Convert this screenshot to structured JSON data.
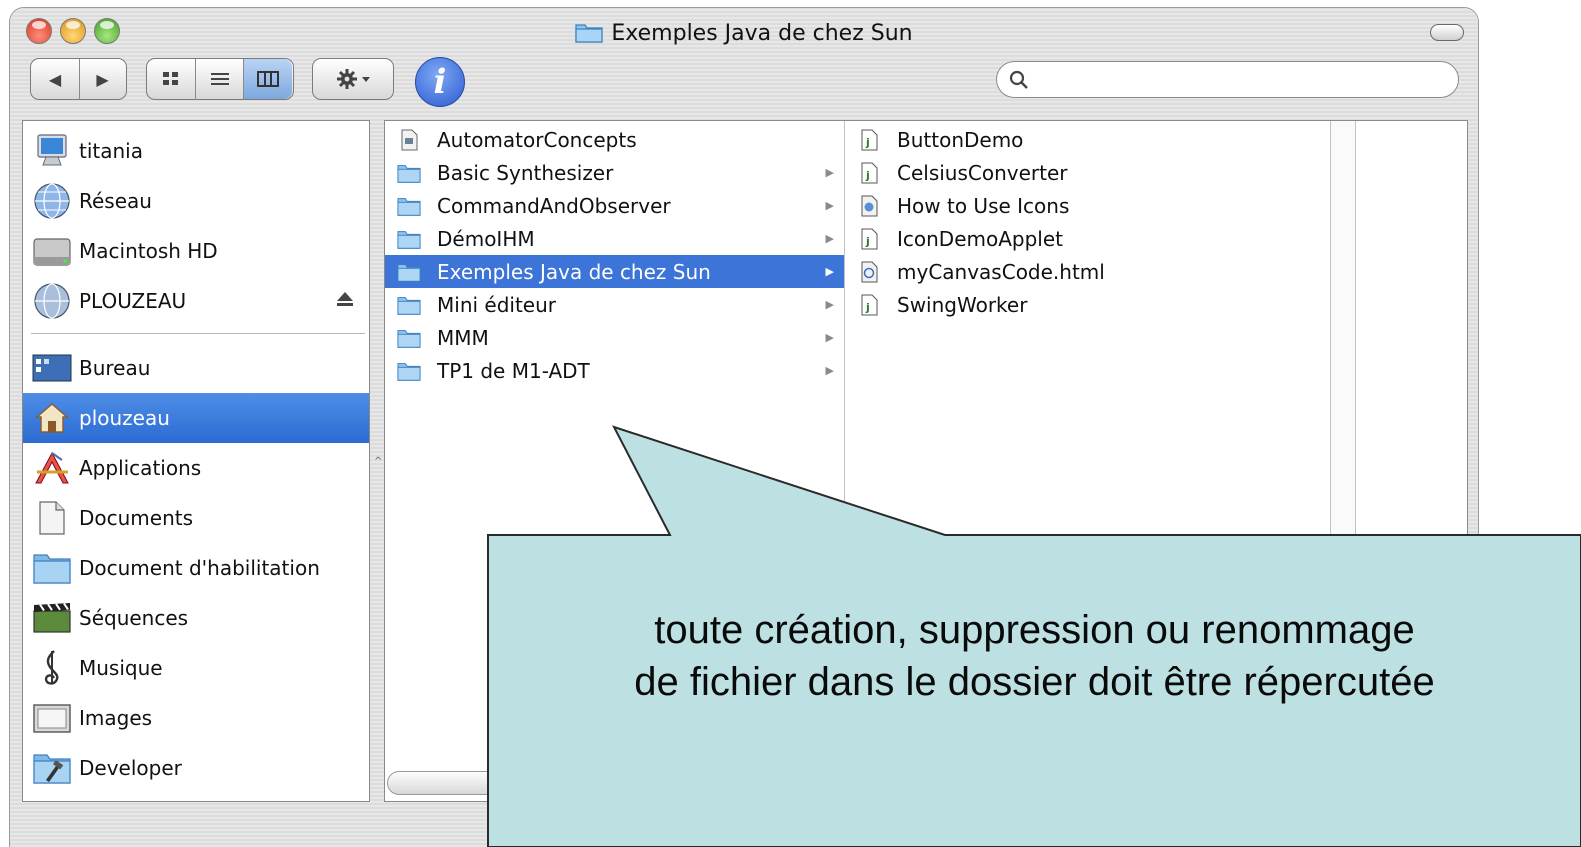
{
  "window": {
    "title": "Exemples Java de chez Sun",
    "title_icon": "folder-icon"
  },
  "toolbar": {
    "back_label": "◀",
    "forward_label": "▶",
    "view_icon_label": "icon-view-icon",
    "view_list_label": "list-view-icon",
    "view_column_label": "column-view-icon",
    "active_view": "column",
    "action_icon": "gear-icon",
    "info_label": "i",
    "search_placeholder": "",
    "search_value": ""
  },
  "sidebar": {
    "devices": [
      {
        "label": "titania",
        "icon": "computer-icon"
      },
      {
        "label": "Réseau",
        "icon": "network-globe-icon"
      },
      {
        "label": "Macintosh HD",
        "icon": "hard-drive-icon"
      },
      {
        "label": "PLOUZEAU",
        "icon": "network-volume-icon",
        "eject": true
      }
    ],
    "places": [
      {
        "label": "Bureau",
        "icon": "desktop-icon"
      },
      {
        "label": "plouzeau",
        "icon": "home-icon",
        "selected": true
      },
      {
        "label": "Applications",
        "icon": "applications-icon"
      },
      {
        "label": "Documents",
        "icon": "documents-icon"
      },
      {
        "label": "Document d'habilitation",
        "icon": "folder-icon"
      },
      {
        "label": "Séquences",
        "icon": "movies-icon"
      },
      {
        "label": "Musique",
        "icon": "music-icon"
      },
      {
        "label": "Images",
        "icon": "pictures-icon"
      },
      {
        "label": "Developer",
        "icon": "developer-folder-icon"
      }
    ]
  },
  "column1": [
    {
      "label": "AutomatorConcepts",
      "icon": "document-icon",
      "has_children": false
    },
    {
      "label": "Basic Synthesizer",
      "icon": "folder-icon",
      "has_children": true
    },
    {
      "label": "CommandAndObserver",
      "icon": "folder-icon",
      "has_children": true
    },
    {
      "label": "DémoIHM",
      "icon": "folder-icon",
      "has_children": true
    },
    {
      "label": "Exemples Java de chez Sun",
      "icon": "folder-icon",
      "has_children": true,
      "selected": true
    },
    {
      "label": "Mini éditeur",
      "icon": "folder-icon",
      "has_children": true
    },
    {
      "label": "MMM",
      "icon": "folder-icon",
      "has_children": true
    },
    {
      "label": "TP1 de M1-ADT",
      "icon": "folder-icon",
      "has_children": true
    }
  ],
  "column2": [
    {
      "label": "ButtonDemo",
      "icon": "java-file-icon"
    },
    {
      "label": "CelsiusConverter",
      "icon": "java-file-icon"
    },
    {
      "label": "How to Use Icons",
      "icon": "web-archive-icon"
    },
    {
      "label": "IconDemoApplet",
      "icon": "java-file-icon"
    },
    {
      "label": "myCanvasCode.html",
      "icon": "html-file-icon"
    },
    {
      "label": "SwingWorker",
      "icon": "java-file-icon"
    }
  ],
  "callout": {
    "line1": "toute création, suppression ou renommage",
    "line2": "de fichier dans le dossier doit être répercutée"
  },
  "colors": {
    "selection_blue": "#3c74d8",
    "callout_fill": "#bde0e3",
    "callout_stroke": "#2a2a2a"
  }
}
